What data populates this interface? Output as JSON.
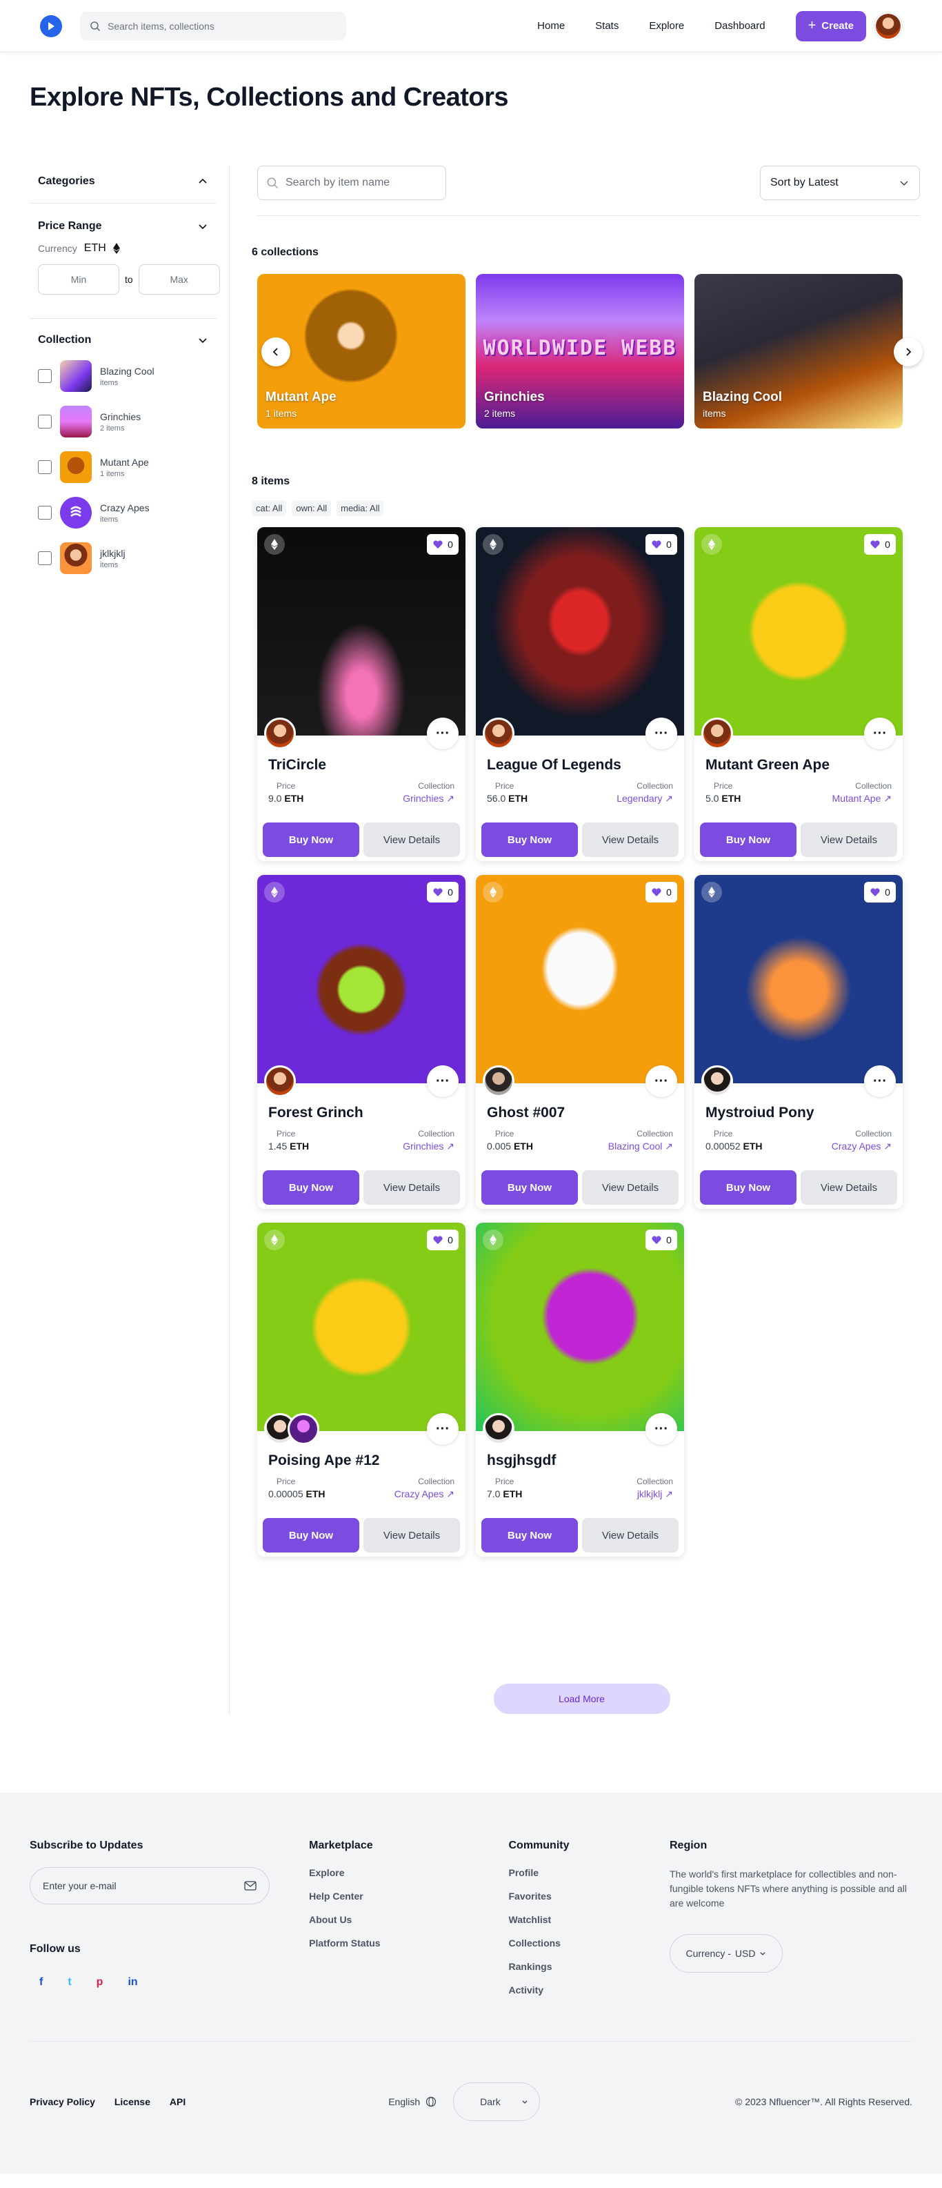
{
  "header": {
    "search_placeholder": "Search items, collections",
    "nav": [
      "Home",
      "Stats",
      "Explore",
      "Dashboard"
    ],
    "create_label": "Create"
  },
  "page_title": "Explore NFTs, Collections and Creators",
  "sidebar": {
    "categories_label": "Categories",
    "price_range_label": "Price Range",
    "currency_label": "Currency",
    "currency_value": "ETH",
    "min_placeholder": "Min",
    "to_label": "to",
    "max_placeholder": "Max",
    "collection_label": "Collection",
    "collections": [
      {
        "name": "Blazing Cool",
        "sub": "items"
      },
      {
        "name": "Grinchies",
        "sub": "2 items"
      },
      {
        "name": "Mutant Ape",
        "sub": "1 items"
      },
      {
        "name": "Crazy Apes",
        "sub": "items"
      },
      {
        "name": "jklkjklj",
        "sub": "items"
      }
    ]
  },
  "toolbar": {
    "search_placeholder": "Search by item name",
    "sort_label": "Sort by Latest"
  },
  "collections_count": "6 collections",
  "carousel": [
    {
      "title": "Mutant Ape",
      "sub": "1 items"
    },
    {
      "title": "Grinchies",
      "sub": "2 items"
    },
    {
      "title": "Blazing Cool",
      "sub": "items"
    }
  ],
  "grinchies_banner_text": "WORLDWIDE WEBB",
  "items_count": "8 items",
  "filters": [
    "cat: All",
    "own: All",
    "media: All"
  ],
  "labels": {
    "price": "Price",
    "collection": "Collection",
    "buy": "Buy Now",
    "view": "View Details",
    "eth": "ETH",
    "likes": "0",
    "more": "···"
  },
  "items": [
    {
      "title": "TriCircle",
      "price": "9.0",
      "collection": "Grinchies"
    },
    {
      "title": "League Of Legends",
      "price": "56.0",
      "collection": "Legendary"
    },
    {
      "title": "Mutant Green Ape",
      "price": "5.0",
      "collection": "Mutant Ape"
    },
    {
      "title": "Forest Grinch",
      "price": "1.45",
      "collection": "Grinchies"
    },
    {
      "title": "Ghost #007",
      "price": "0.005",
      "collection": "Blazing Cool"
    },
    {
      "title": "Mystroiud Pony",
      "price": "0.00052",
      "collection": "Crazy Apes"
    },
    {
      "title": "Poising Ape #12",
      "price": "0.00005",
      "collection": "Crazy Apes"
    },
    {
      "title": "hsgjhsgdf",
      "price": "7.0",
      "collection": "jklkjklj"
    }
  ],
  "load_more": "Load More",
  "footer": {
    "subscribe_title": "Subscribe to Updates",
    "email_placeholder": "Enter your e-mail",
    "follow_title": "Follow us",
    "marketplace_title": "Marketplace",
    "marketplace_links": [
      "Explore",
      "Help Center",
      "About Us",
      "Platform Status"
    ],
    "community_title": "Community",
    "community_links": [
      "Profile",
      "Favorites",
      "Watchlist",
      "Collections",
      "Rankings",
      "Activity"
    ],
    "region_title": "Region",
    "region_text": "The world's first marketplace for collectibles and non-fungible tokens NFTs where anything is possible and all are welcome",
    "currency_label": "Currency -",
    "currency_value": "USD",
    "legal": [
      "Privacy Policy",
      "License",
      "API"
    ],
    "language": "English",
    "theme": "Dark",
    "copyright": "© 2023 Nfluencer™. All Rights Reserved."
  },
  "colors": {
    "accent": "#7c4ce0",
    "logo": "#2563eb"
  }
}
